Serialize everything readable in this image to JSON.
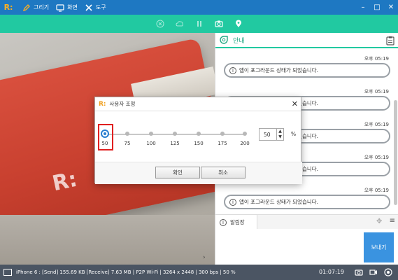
{
  "app": {
    "logo": "R:"
  },
  "menu": [
    {
      "label": "그리기",
      "icon": "pen-icon"
    },
    {
      "label": "화면",
      "icon": "monitor-icon"
    },
    {
      "label": "도구",
      "icon": "tools-icon"
    }
  ],
  "toolbar": {
    "icons": [
      "freeze-icon",
      "cloud-icon",
      "pause-icon",
      "camera-icon",
      "location-pin-icon"
    ]
  },
  "panel": {
    "title": "안내",
    "messages": [
      {
        "time": "오후 05:19",
        "text": "앱이 포그라운드 상태가 되었습니다."
      },
      {
        "time": "오후 05:19",
        "text": "앱이 포그라운드 상태가 되었습니다."
      },
      {
        "time": "오후 05:19",
        "text": "앱이 포그라운드 상태가 되었습니다."
      },
      {
        "time": "오후 05:19",
        "text": "앱이 포그라운드 상태가 되었습니다."
      },
      {
        "time": "오후 05:19",
        "text": "앱이 포그라운드 상태가 되었습니다."
      }
    ],
    "alarm_tab": "알림장",
    "send_label": "보내기"
  },
  "dialog": {
    "logo": "R:",
    "title": "사용자 조정",
    "ticks": [
      "50",
      "75",
      "100",
      "125",
      "150",
      "175",
      "200"
    ],
    "value": "50",
    "unit": "%",
    "ok_label": "확인",
    "cancel_label": "취소",
    "stepper_up": "▲",
    "stepper_down": "▼"
  },
  "status": {
    "text": "iPhone 6 : [Send] 155.69 KB  [Receive] 7.63 MB | P2P Wi-Fi | 3264 x 2448 | 300 bps | 50 %",
    "timer": "01:07:19"
  },
  "colors": {
    "titlebar": "#1e78c2",
    "toolbar": "#21c9a1",
    "accent": "#21a883",
    "send": "#3a93e0",
    "highlight": "#e02020",
    "statusbar": "#4b5563"
  }
}
